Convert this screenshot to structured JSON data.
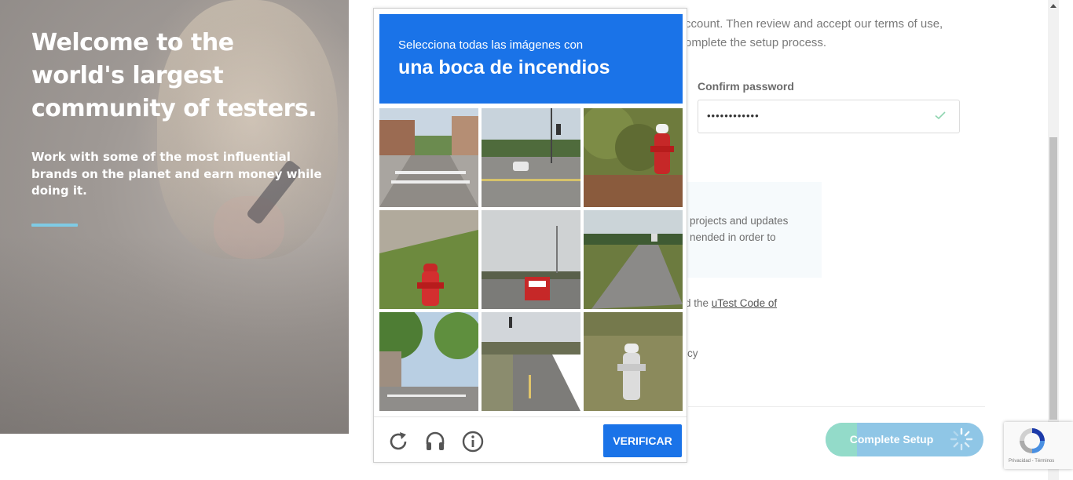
{
  "hero": {
    "title": "Welcome to the world's largest community of testers.",
    "subtitle": "Work with some of the most influential brands on the planet and earn money while doing it.",
    "accent_color": "#7fcbe5"
  },
  "form": {
    "intro_line1": "ccount. Then review and accept our terms of use,",
    "intro_line2": "omplete the setup process.",
    "confirm_password_label": "Confirm password",
    "confirm_password_value": "••••••••••••",
    "info_line1": "projects and updates",
    "info_line2": "nended in order to",
    "code_prefix": "d the ",
    "code_link": "uTest Code of",
    "policy_fragment": "icy",
    "complete_setup_label": "Complete Setup"
  },
  "captcha": {
    "instruction": "Selecciona todas las imágenes con",
    "object": "una boca de incendios",
    "verify_label": "VERIFICAR",
    "header_color": "#1a73e8",
    "tiles": [
      {
        "icon": "street-crossing-photo"
      },
      {
        "icon": "intersection-with-car-photo"
      },
      {
        "icon": "red-hydrant-in-bushes-photo"
      },
      {
        "icon": "red-hydrant-on-grass-photo"
      },
      {
        "icon": "highway-bridge-truck-photo"
      },
      {
        "icon": "highway-lane-photo"
      },
      {
        "icon": "tree-lined-street-photo"
      },
      {
        "icon": "road-with-traffic-lights-photo"
      },
      {
        "icon": "white-hydrant-photo"
      }
    ],
    "controls": [
      "reload-icon",
      "audio-headphones-icon",
      "info-icon"
    ]
  },
  "recaptcha_badge": {
    "terms": "Privacidad - Términos"
  }
}
